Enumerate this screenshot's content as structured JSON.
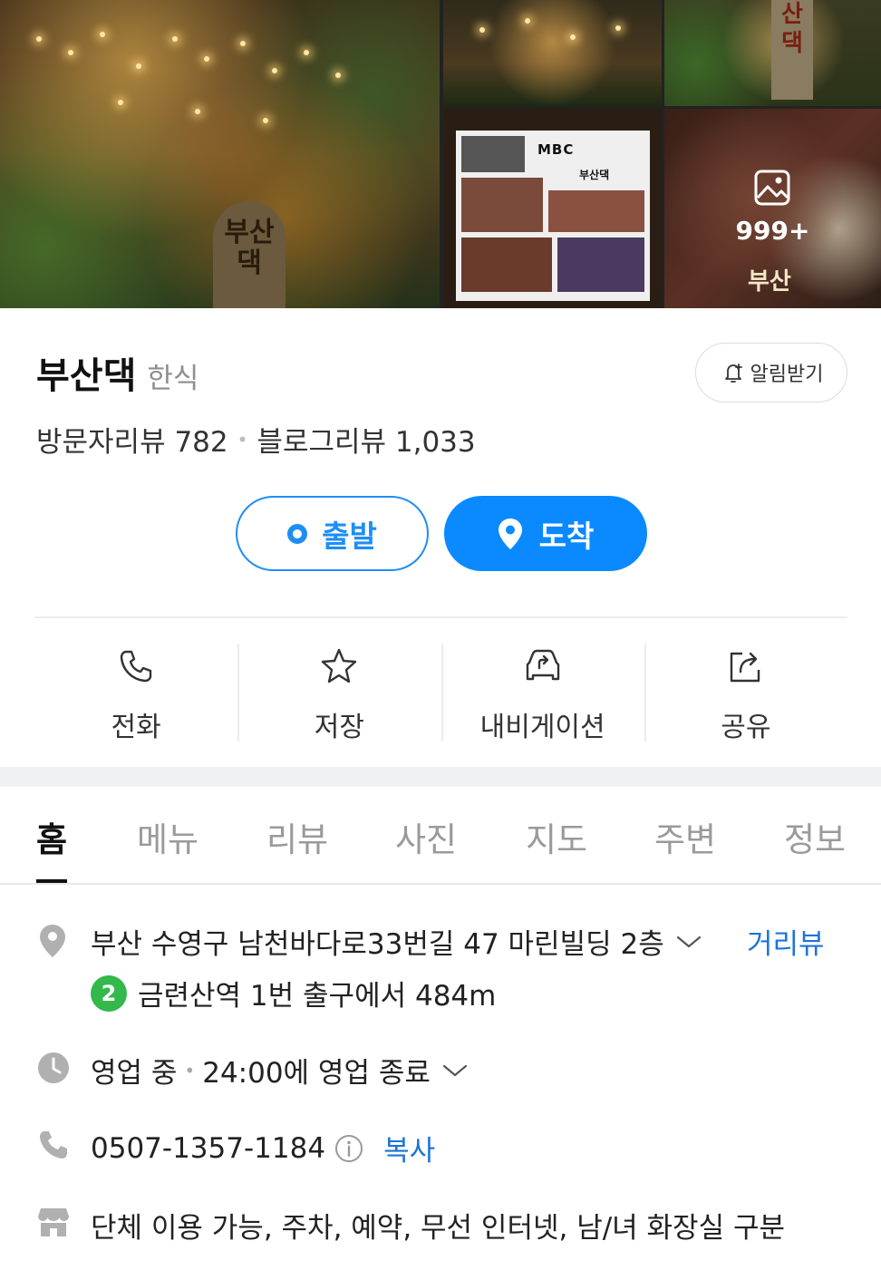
{
  "gallery": {
    "main_sign_text": "부산댁",
    "photo_count": "999+",
    "mbc_logo": "MBC",
    "board_name": "부산댁",
    "watermark": "부산"
  },
  "place": {
    "name": "부산댁",
    "category": "한식",
    "alarm_label": "알림받기",
    "visitor_reviews": "방문자리뷰 782",
    "blog_reviews": "블로그리뷰 1,033"
  },
  "route": {
    "start_label": "출발",
    "dest_label": "도착"
  },
  "actions": [
    {
      "label": "전화",
      "icon": "phone-icon"
    },
    {
      "label": "저장",
      "icon": "star-icon"
    },
    {
      "label": "내비게이션",
      "icon": "car-navigation-icon"
    },
    {
      "label": "공유",
      "icon": "share-icon"
    }
  ],
  "tabs": [
    "홈",
    "메뉴",
    "리뷰",
    "사진",
    "지도",
    "주변",
    "정보"
  ],
  "info": {
    "address": "부산 수영구 남천바다로33번길 47 마린빌딩 2층",
    "street_view": "거리뷰",
    "subway_line": "2",
    "subway_directions": "금련산역 1번 출구에서 484m",
    "status": "영업 중",
    "hours": "24:00에 영업 종료",
    "phone": "0507-1357-1184",
    "copy_label": "복사",
    "amenities": "단체 이용 가능, 주차, 예약, 무선 인터넷, 남/녀 화장실 구분"
  },
  "colors": {
    "accent": "#0b8aff",
    "link": "#1e74d8",
    "subway_line_2": "#33b84a"
  }
}
